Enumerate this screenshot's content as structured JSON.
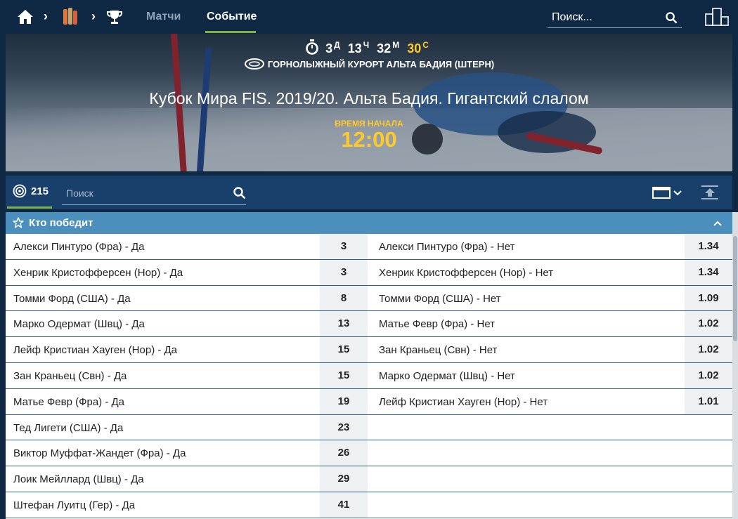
{
  "nav": {
    "tabs": [
      "Матчи",
      "Событие"
    ],
    "active_tab": "Событие",
    "search_placeholder": "Поиск..."
  },
  "banner": {
    "countdown": {
      "days": "3",
      "days_unit": "Д",
      "hours": "13",
      "hours_unit": "Ч",
      "minutes": "32",
      "minutes_unit": "М",
      "seconds": "30",
      "seconds_unit": "С"
    },
    "venue": "ГОРНОЛЫЖНЫЙ КУРОРТ АЛЬТА БАДИЯ (ШТЕРН)",
    "title": "Кубок Мира FIS. 2019/20. Альта Бадия. Гигантский слалом",
    "start_label": "ВРЕМЯ НАЧАЛА",
    "start_time": "12:00"
  },
  "toolbar": {
    "count": "215",
    "search_placeholder": "Поиск"
  },
  "market": {
    "title": "Кто победит",
    "rows": [
      {
        "left_name": "Алекси Пинтуро (Фра) - Да",
        "left_odd": "3",
        "right_name": "Алекси Пинтуро (Фра) - Нет",
        "right_odd": "1.34"
      },
      {
        "left_name": "Хенрик Кристофферсен (Нор) - Да",
        "left_odd": "3",
        "right_name": "Хенрик Кристофферсен (Нор) - Нет",
        "right_odd": "1.34"
      },
      {
        "left_name": "Томми Форд (США) - Да",
        "left_odd": "8",
        "right_name": "Томми Форд (США) - Нет",
        "right_odd": "1.09"
      },
      {
        "left_name": "Марко Одермат (Швц) - Да",
        "left_odd": "13",
        "right_name": "Матье Февр (Фра) - Нет",
        "right_odd": "1.02"
      },
      {
        "left_name": "Лейф Кристиан Хауген (Нор) - Да",
        "left_odd": "15",
        "right_name": "Зан Краньец (Свн) - Нет",
        "right_odd": "1.02"
      },
      {
        "left_name": "Зан Краньец (Свн) - Да",
        "left_odd": "15",
        "right_name": "Марко Одермат (Швц) - Нет",
        "right_odd": "1.02"
      },
      {
        "left_name": "Матье Февр (Фра) - Да",
        "left_odd": "19",
        "right_name": "Лейф Кристиан Хауген (Нор) - Нет",
        "right_odd": "1.01"
      },
      {
        "left_name": "Тед Лигети (США) - Да",
        "left_odd": "23",
        "right_name": "",
        "right_odd": ""
      },
      {
        "left_name": "Виктор Муффат-Жандет (Фра) - Да",
        "left_odd": "26",
        "right_name": "",
        "right_odd": ""
      },
      {
        "left_name": "Лоик Мейллард (Швц) - Да",
        "left_odd": "29",
        "right_name": "",
        "right_odd": ""
      },
      {
        "left_name": "Штефан Луитц (Гер) - Да",
        "left_odd": "41",
        "right_name": "",
        "right_odd": ""
      }
    ]
  },
  "colors": {
    "nav_bg": "#0f2843",
    "toolbar_bg": "#18406a",
    "market_header_bg": "#4b8fbd",
    "accent_green": "#7cb342",
    "accent_yellow": "#ffca28",
    "odd_bg": "#eef0f2"
  },
  "icons": [
    "home-icon",
    "sport-icon",
    "trophy-icon",
    "search-icon",
    "podium-icon",
    "timer-icon",
    "stadium-icon",
    "target-icon",
    "view-toggle-icon",
    "collapse-icon",
    "star-icon",
    "chevron-up-icon"
  ]
}
